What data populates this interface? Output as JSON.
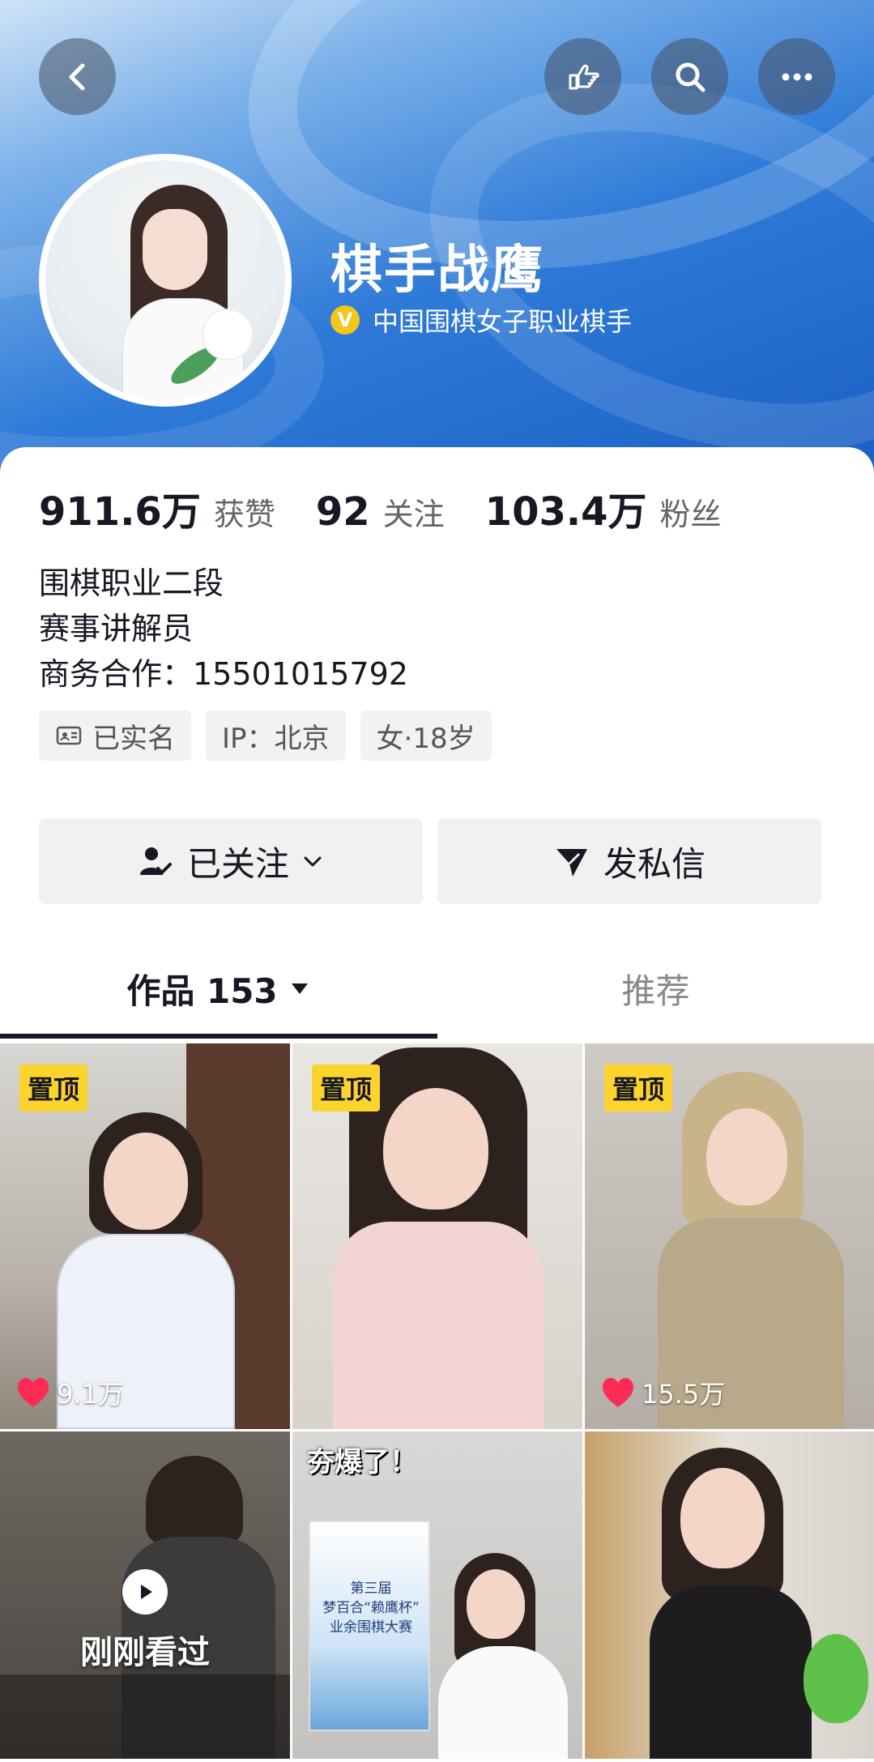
{
  "header": {
    "name": "棋手战鹰",
    "verify_badge": "V",
    "verify_text": "中国围棋女子职业棋手"
  },
  "stats": [
    {
      "value": "911.6万",
      "label": "获赞"
    },
    {
      "value": "92",
      "label": "关注"
    },
    {
      "value": "103.4万",
      "label": "粉丝"
    }
  ],
  "bio": {
    "line1": "围棋职业二段",
    "line2": "赛事讲解员",
    "line3": "商务合作：15501015792"
  },
  "tags": {
    "realname": "已实名",
    "ip": "IP：北京",
    "gender_age": "女·18岁"
  },
  "actions": {
    "follow": "已关注",
    "message": "发私信"
  },
  "tabs": {
    "works": "作品 153",
    "recommend": "推荐"
  },
  "grid": {
    "pin_label": "置顶",
    "items": [
      {
        "likes": "9.1万"
      },
      {
        "likes": ""
      },
      {
        "likes": "15.5万"
      }
    ],
    "watched_label": "刚刚看过",
    "overlay_text": "夯爆了！",
    "poster_line1": "第三届",
    "poster_line2": "梦百合“赖鹰杯”",
    "poster_line3": "业余围棋大赛"
  },
  "colors": {
    "accent_yellow": "#fdd32e",
    "heart_red": "#fe2c55",
    "header_blue": "#2f7bd8"
  }
}
